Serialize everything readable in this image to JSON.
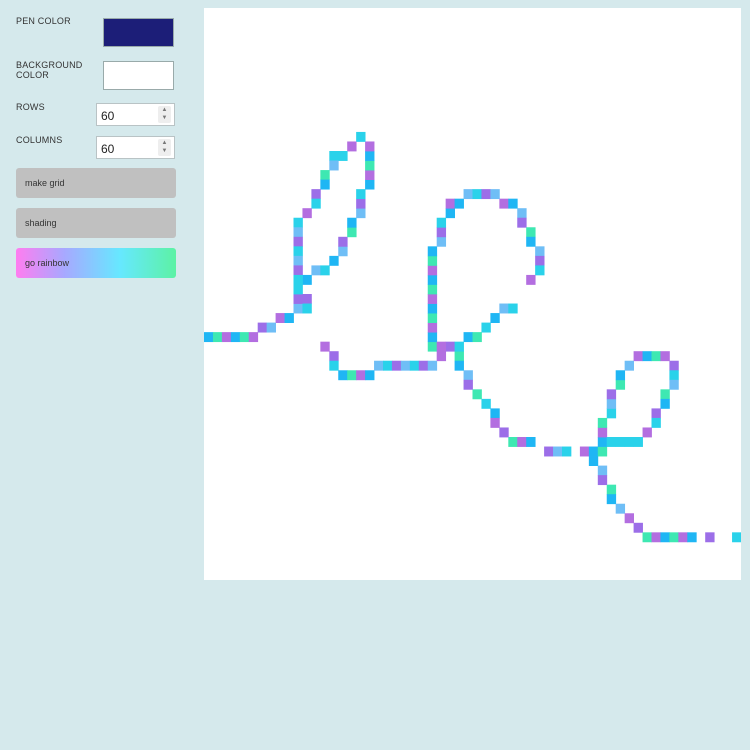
{
  "controls": {
    "pen_color_label": "PEN COLOR",
    "pen_color": "#1c1e78",
    "background_color_label": "BACKGROUND COLOR",
    "background_color": "#ffffff",
    "rows_label": "ROWS",
    "rows_value": "60",
    "columns_label": "COLUMNS",
    "columns_value": "60"
  },
  "buttons": {
    "make_grid": "make grid",
    "shading": "shading",
    "go_rainbow": "go rainbow"
  },
  "colors": {
    "page_background": "#d5e9ec",
    "canvas_background": "#ffffff",
    "rainbow_palette": [
      "#1fb6f4",
      "#2ad2ea",
      "#3ee8b2",
      "#9c6ee8",
      "#b36ee0",
      "#6fbef6"
    ]
  }
}
